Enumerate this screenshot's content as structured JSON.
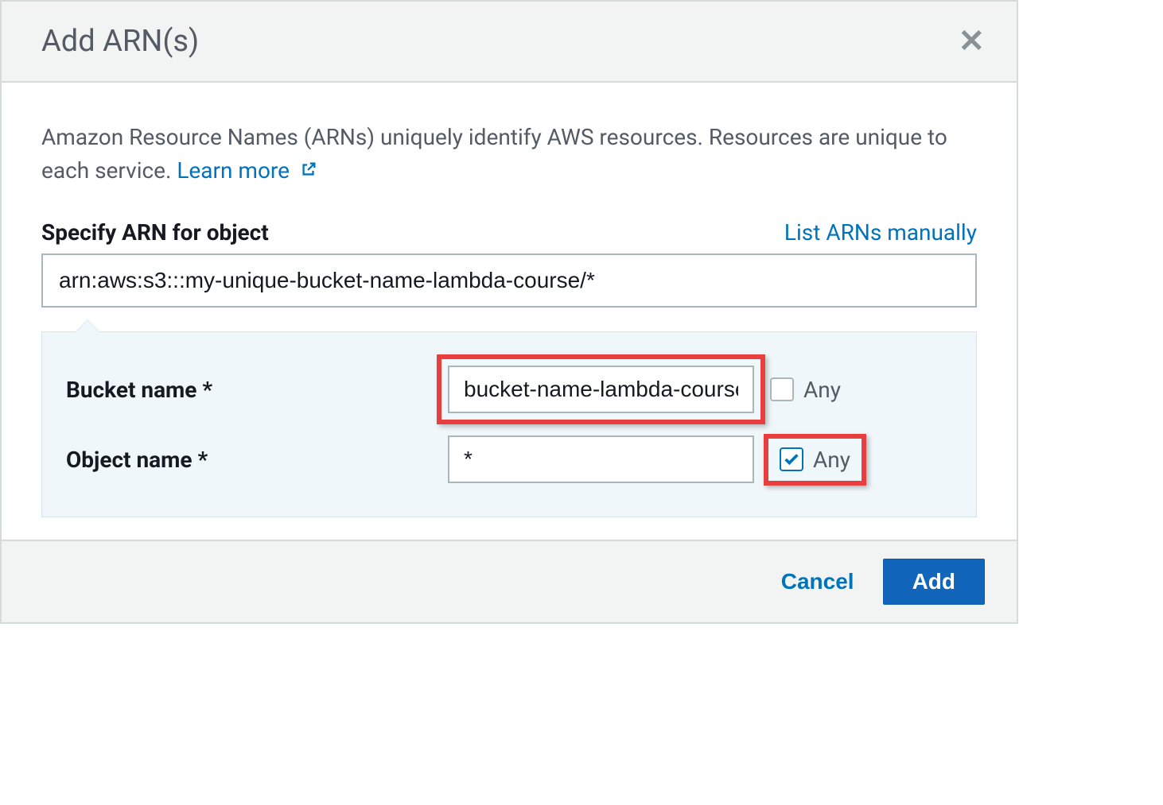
{
  "modal": {
    "title": "Add ARN(s)",
    "description_prefix": "Amazon Resource Names (ARNs) uniquely identify AWS resources. Resources are unique to each service. ",
    "learn_more": "Learn more",
    "specify_label": "Specify ARN for object",
    "manual_link": "List ARNs manually",
    "arn_value": "arn:aws:s3:::my-unique-bucket-name-lambda-course/*",
    "fields": {
      "bucket": {
        "label": "Bucket name *",
        "value": "bucket-name-lambda-course",
        "any_label": "Any",
        "any_checked": false
      },
      "object": {
        "label": "Object name *",
        "value": "*",
        "any_label": "Any",
        "any_checked": true
      }
    }
  },
  "footer": {
    "cancel": "Cancel",
    "add": "Add"
  }
}
